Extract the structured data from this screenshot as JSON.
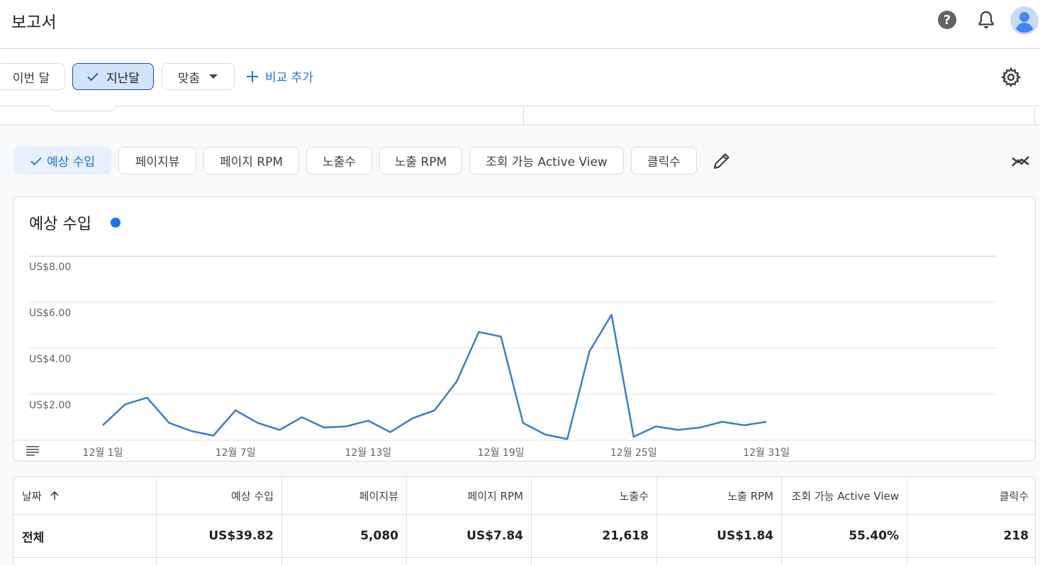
{
  "header": {
    "title": "보고서",
    "icons": [
      "help-icon",
      "bell-icon",
      "account-avatar-icon"
    ]
  },
  "filters": {
    "chips": [
      {
        "label": "이번 달",
        "selected": false
      },
      {
        "label": "지난달",
        "selected": true
      },
      {
        "label": "맞춤",
        "selected": false,
        "dropdown": true
      }
    ],
    "add_compare_label": "비교 추가"
  },
  "metrics": {
    "chips": [
      {
        "label": "예상 수입",
        "selected": true
      },
      {
        "label": "페이지뷰",
        "selected": false
      },
      {
        "label": "페이지 RPM",
        "selected": false
      },
      {
        "label": "노출수",
        "selected": false
      },
      {
        "label": "노출 RPM",
        "selected": false
      },
      {
        "label": "조회 가능 Active View",
        "selected": false
      },
      {
        "label": "클릭수",
        "selected": false
      }
    ]
  },
  "chart": {
    "title": "예상 수입",
    "series_color": "#1a73e8",
    "line_color": "#3a7bd5"
  },
  "chart_data": {
    "type": "line",
    "title": "예상 수입",
    "x": [
      "12월 1일",
      "12월 2일",
      "12월 3일",
      "12월 4일",
      "12월 5일",
      "12월 6일",
      "12월 7일",
      "12월 8일",
      "12월 9일",
      "12월 10일",
      "12월 11일",
      "12월 12일",
      "12월 13일",
      "12월 14일",
      "12월 15일",
      "12월 16일",
      "12월 17일",
      "12월 18일",
      "12월 19일",
      "12월 20일",
      "12월 21일",
      "12월 22일",
      "12월 23일",
      "12월 24일",
      "12월 25일",
      "12월 26일",
      "12월 27일",
      "12월 28일",
      "12월 29일",
      "12월 30일",
      "12월 31일"
    ],
    "x_tick_labels": [
      "12월 1일",
      "12월 7일",
      "12월 13일",
      "12월 19일",
      "12월 25일",
      "12월 31일"
    ],
    "y_tick_labels": [
      "US$2.00",
      "US$4.00",
      "US$6.00",
      "US$8.00"
    ],
    "series": [
      {
        "values": [
          0.65,
          1.55,
          1.85,
          0.75,
          0.4,
          0.2,
          1.3,
          0.75,
          0.45,
          1.0,
          0.55,
          0.6,
          0.85,
          0.35,
          0.95,
          1.3,
          2.55,
          4.7,
          4.5,
          0.75,
          0.25,
          0.05,
          3.85,
          5.45,
          0.15,
          0.6,
          0.45,
          0.55,
          0.8,
          0.65,
          0.8
        ]
      }
    ],
    "ylim": [
      0,
      8.8
    ],
    "grid": true
  },
  "table": {
    "columns": [
      "날짜",
      "예상 수입",
      "페이지뷰",
      "페이지 RPM",
      "노출수",
      "노출 RPM",
      "조회 가능 Active View",
      "클릭수"
    ],
    "total_row": [
      "전체",
      "US$39.82",
      "5,080",
      "US$7.84",
      "21,618",
      "US$1.84",
      "55.40%",
      "218"
    ]
  }
}
